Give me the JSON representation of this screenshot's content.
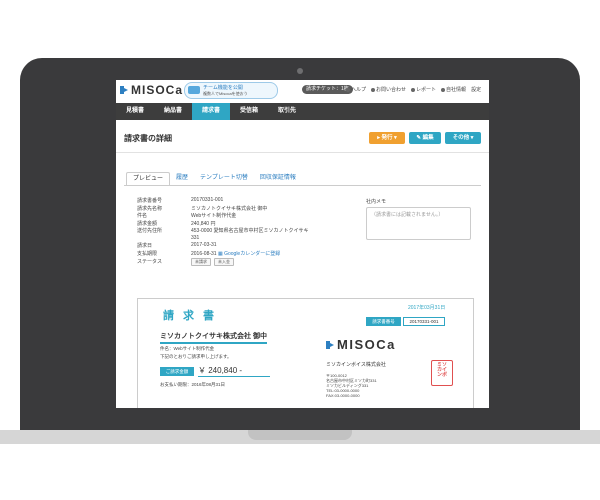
{
  "app": {
    "logo": "MISOCa",
    "promo": {
      "line1": "チーム機能を公開",
      "line2": "複数人でMisocaを使おう"
    },
    "ticket": "請求チケット：1枚",
    "toplinks": [
      "ヘルプ",
      "お問い合わせ",
      "レポート",
      "自社情報",
      "設定"
    ]
  },
  "nav": {
    "items": [
      "見積書",
      "納品書",
      "請求書",
      "受信箱",
      "取引先"
    ],
    "active_index": 2
  },
  "header": {
    "title": "請求書の詳細",
    "buttons": {
      "issue": "発行",
      "edit": "編集",
      "other": "その他"
    }
  },
  "tabs": {
    "items": [
      "プレビュー",
      "履歴",
      "テンプレート切替",
      "回収保証情報"
    ],
    "active_index": 0
  },
  "details": {
    "rows": [
      {
        "label": "請求書番号",
        "value": "20170331-001"
      },
      {
        "label": "請求先名称",
        "value": "ミソカノトクイサキ株式会社 御中"
      },
      {
        "label": "件名",
        "value": "Webサイト制作代金"
      },
      {
        "label": "請求金額",
        "value": "240,840 円"
      },
      {
        "label": "送付先住所",
        "value": "453-0000 愛知県名古屋市中村区ミソカノトクイサキ"
      },
      {
        "label": "",
        "value": "331"
      },
      {
        "label": "請求日",
        "value": "2017-03-31"
      },
      {
        "label": "支払期限",
        "value": "2016-08-31"
      }
    ],
    "calendar_link": "Googleカレンダーに登録",
    "status_label": "ステータス",
    "status_badges": [
      "未請求",
      "未入金"
    ]
  },
  "memo": {
    "label": "社内メモ",
    "placeholder": "（請求書には記載されません。）"
  },
  "invoice": {
    "title": "請求書",
    "date": "2017年03月31日",
    "number_label": "請求書番号",
    "number": "20170331-001",
    "client": "ミソカノトクイサキ株式会社 御中",
    "subject": "件名：Webサイト制作代金",
    "note": "下記のとおりご請求申し上げます。",
    "amount_label": "ご請求金額",
    "amount": "￥ 240,840 -",
    "due": "お支払い期限：2016年08月31日",
    "logo": "MISOCa",
    "company": "ミソカインボイス株式会社",
    "address": [
      "〒100-0012",
      "名古屋市中村区ミソカ町331",
      "ミソカビルディング331",
      "TEL:03-0000-0000",
      "FAX:03-0000-0000"
    ],
    "seal": [
      "ミソ",
      "カイ",
      "ンボ"
    ]
  },
  "colors": {
    "accent": "#2fa6c4",
    "nav_bg": "#3d3d3d",
    "orange": "#f0a030",
    "logo_blue": "#2d7fc1"
  }
}
